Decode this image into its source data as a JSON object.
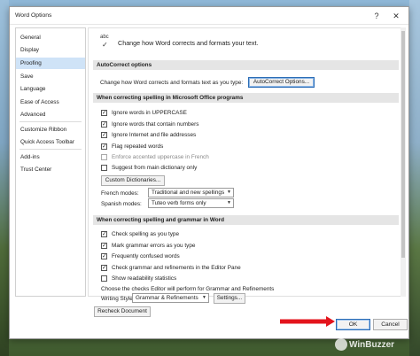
{
  "window": {
    "title": "Word Options",
    "help_glyph": "?",
    "close_glyph": "✕"
  },
  "sidebar": {
    "items": [
      {
        "label": "General"
      },
      {
        "label": "Display"
      },
      {
        "label": "Proofing",
        "selected": true
      },
      {
        "label": "Save"
      },
      {
        "label": "Language"
      },
      {
        "label": "Ease of Access"
      },
      {
        "label": "Advanced"
      },
      {
        "label": "Customize Ribbon"
      },
      {
        "label": "Quick Access Toolbar"
      },
      {
        "label": "Add-ins"
      },
      {
        "label": "Trust Center"
      }
    ]
  },
  "header": {
    "icon_text": "abc",
    "icon_mark": "✓",
    "text": "Change how Word corrects and formats your text."
  },
  "autocorrect": {
    "section_title": "AutoCorrect options",
    "description": "Change how Word corrects and formats text as you type:",
    "button_label": "AutoCorrect Options..."
  },
  "office_spelling": {
    "section_title": "When correcting spelling in Microsoft Office programs",
    "options": [
      {
        "label": "Ignore words in UPPERCASE",
        "checked": true
      },
      {
        "label": "Ignore words that contain numbers",
        "checked": true
      },
      {
        "label": "Ignore Internet and file addresses",
        "checked": true
      },
      {
        "label": "Flag repeated words",
        "checked": true
      },
      {
        "label": "Enforce accented uppercase in French",
        "checked": false,
        "disabled": true
      },
      {
        "label": "Suggest from main dictionary only",
        "checked": false
      }
    ],
    "custom_dict_button": "Custom Dictionaries...",
    "french_modes_label": "French modes:",
    "french_modes_value": "Traditional and new spellings",
    "spanish_modes_label": "Spanish modes:",
    "spanish_modes_value": "Tuteo verb forms only"
  },
  "word_spelling": {
    "section_title": "When correcting spelling and grammar in Word",
    "options": [
      {
        "label": "Check spelling as you type",
        "checked": true
      },
      {
        "label": "Mark grammar errors as you type",
        "checked": true
      },
      {
        "label": "Frequently confused words",
        "checked": true
      },
      {
        "label": "Check grammar and refinements in the Editor Pane",
        "checked": true
      },
      {
        "label": "Show readability statistics",
        "checked": false
      }
    ],
    "editor_note": "Choose the checks Editor will perform for Grammar and Refinements",
    "writing_style_label": "Writing Style:",
    "writing_style_value": "Grammar & Refinements",
    "settings_button": "Settings...",
    "recheck_button": "Recheck Document"
  },
  "footer": {
    "ok_label": "OK",
    "cancel_label": "Cancel"
  },
  "glyphs": {
    "check": "✓",
    "dropdown": "▼"
  },
  "watermark": {
    "text": "WinBuzzer"
  },
  "colors": {
    "selection": "#cfe3f7",
    "section_bg": "#e5e5e5",
    "focus_border": "#2b6cb5",
    "arrow_red": "#e3141c"
  }
}
